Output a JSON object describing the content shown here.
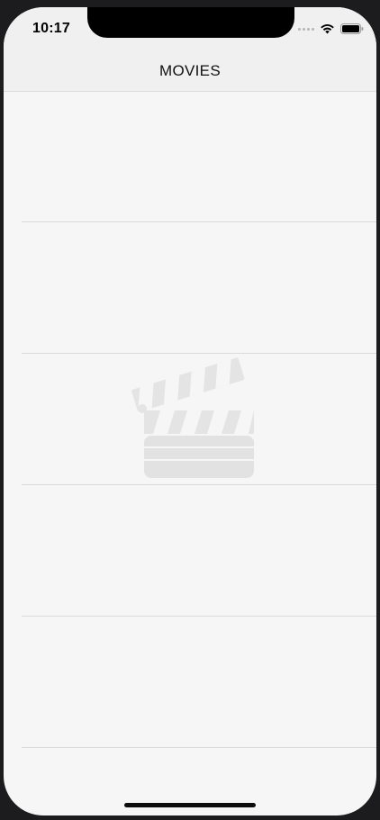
{
  "status_bar": {
    "time": "10:17",
    "icons": [
      "signal-dots-icon",
      "wifi-icon",
      "battery-icon"
    ]
  },
  "navbar": {
    "title": "MOVIES"
  },
  "table": {
    "rows": [
      {
        "content": ""
      },
      {
        "content": ""
      },
      {
        "content": ""
      },
      {
        "content": ""
      },
      {
        "content": ""
      }
    ]
  },
  "placeholder": {
    "icon": "clapperboard-icon"
  },
  "colors": {
    "background": "#f6f6f6",
    "navbar": "#f0f0f0",
    "separator": "#dadada",
    "placeholder_icon": "#e0e0e0"
  }
}
